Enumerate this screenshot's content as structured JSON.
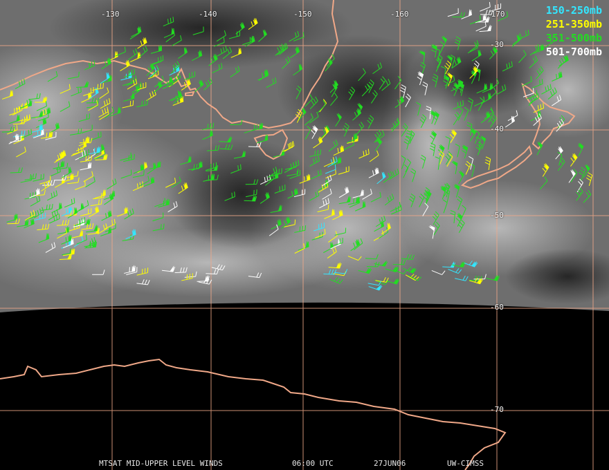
{
  "title": {
    "product": "MTSAT MID-UPPER LEVEL WINDS",
    "time": "06:00 UTC",
    "date": "27JUN06",
    "source": "UW-CIMSS"
  },
  "legend": [
    {
      "label": "150-250mb",
      "color": "#33e6ff"
    },
    {
      "label": "251-350mb",
      "color": "#ffff00"
    },
    {
      "label": "351-500mb",
      "color": "#22dd22"
    },
    {
      "label": "501-700mb",
      "color": "#ffffff"
    }
  ],
  "grid": {
    "longitudes": [
      "-130",
      "-140",
      "-150",
      "-160",
      "-170"
    ],
    "latitudes": [
      "-30",
      "-40",
      "-50",
      "-60",
      "-70"
    ],
    "color": "#f0a888"
  },
  "colors": {
    "coastline": "#f0a888",
    "night_side": "#000000",
    "cloud_base": "#8a8a8a"
  }
}
